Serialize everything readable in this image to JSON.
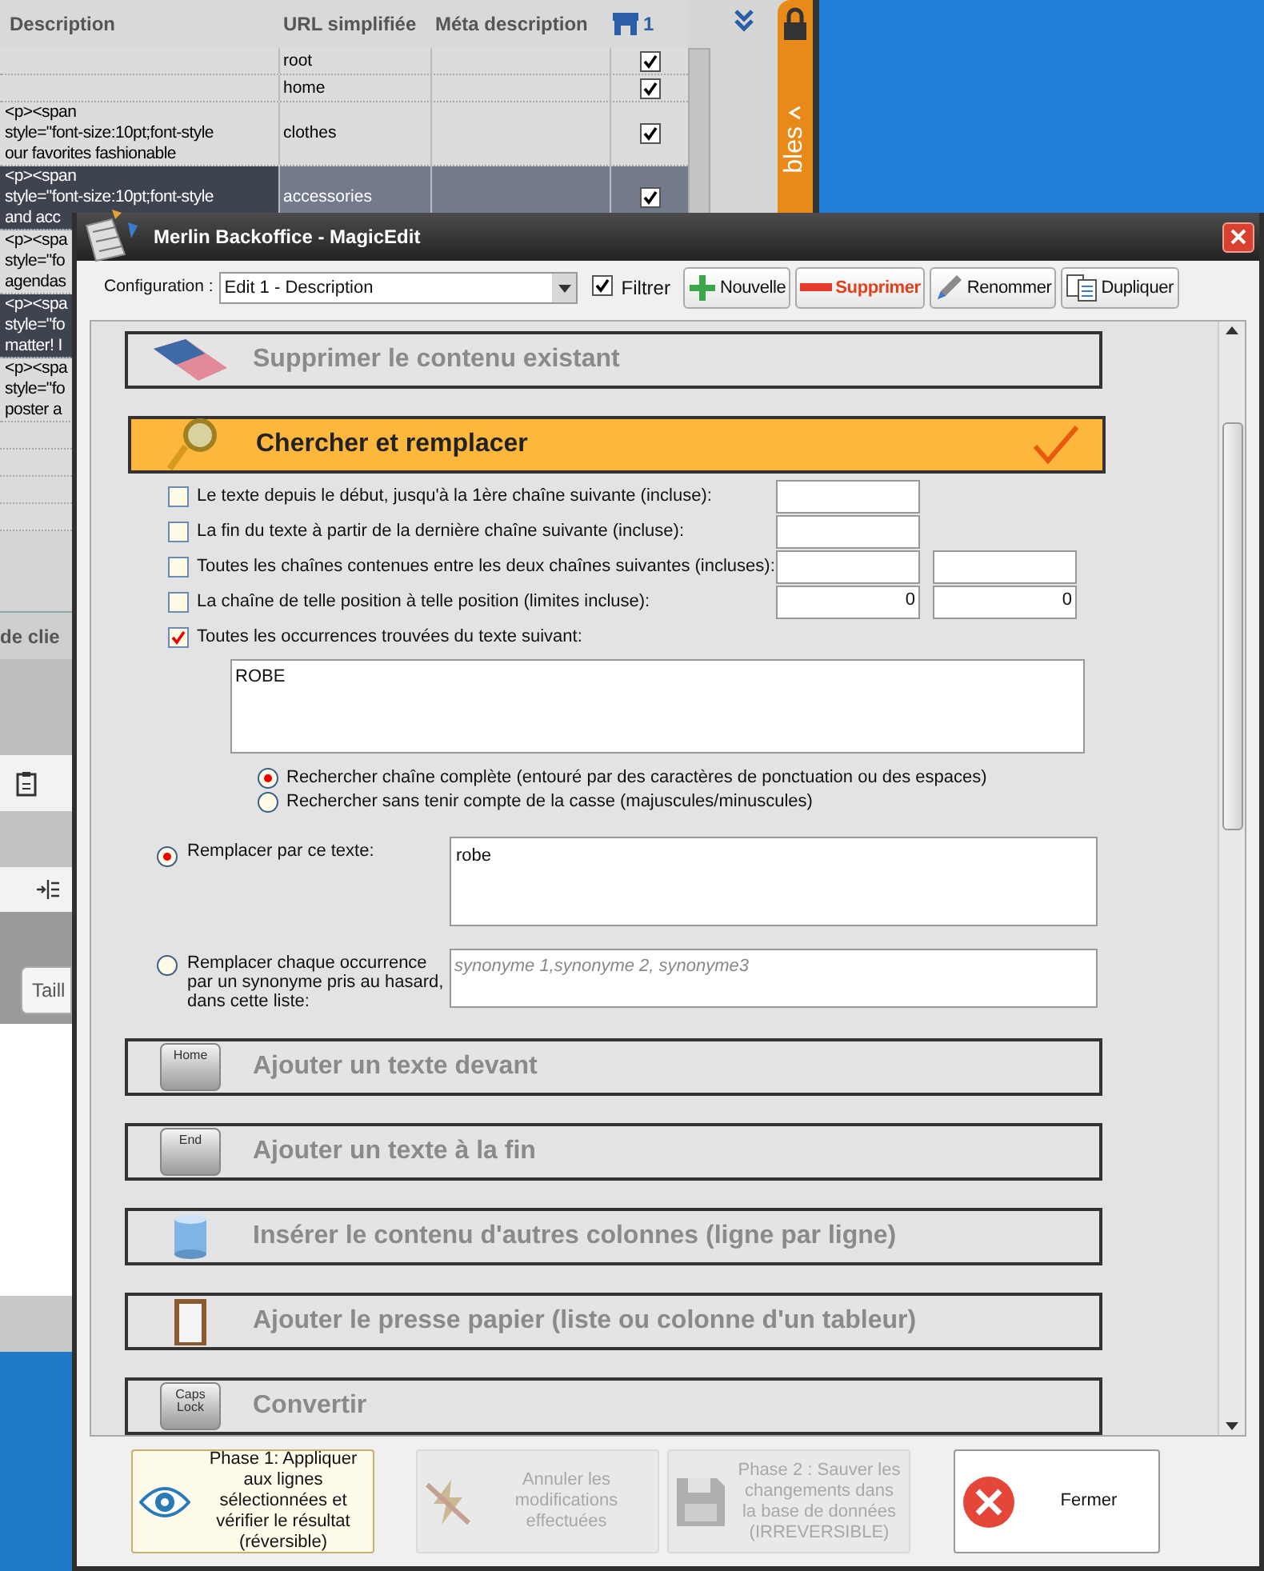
{
  "background_window": {
    "table": {
      "columns": [
        "Description",
        "URL simplifiée",
        "Méta description",
        "1"
      ],
      "rows": [
        {
          "url": "root",
          "checked": true,
          "selected": false
        },
        {
          "url": "home",
          "checked": true,
          "selected": false
        },
        {
          "description": [
            "<p><span",
            "style=\"font-size:10pt;font-style",
            "our favorites fashionable"
          ],
          "url": "clothes",
          "checked": true,
          "selected": false
        },
        {
          "description": [
            "<p><span",
            "style=\"font-size:10pt;font-style",
            "and acc"
          ],
          "url": "accessories",
          "checked": true,
          "selected": true
        },
        {
          "description": [
            "<p><spa",
            "style=\"fo",
            "agendas"
          ],
          "selected": false
        },
        {
          "description": [
            "<p><spa",
            "style=\"fo",
            "matter! I"
          ],
          "selected": true
        },
        {
          "description": [
            "<p><spa",
            "style=\"fo",
            "poster a"
          ],
          "selected": false
        }
      ]
    },
    "side_tab": "bles",
    "tab_label": "de clie",
    "button_label": "Taill"
  },
  "dialog": {
    "title": "Merlin Backoffice - MagicEdit",
    "config_label": "Configuration :",
    "config_value": "Edit 1 - Description",
    "filter": {
      "label": "Filtrer",
      "checked": true
    },
    "toolbar": [
      {
        "label": "Nouvelle",
        "kind": "add"
      },
      {
        "label": "Supprimer",
        "kind": "delete"
      },
      {
        "label": "Renommer",
        "kind": "rename"
      },
      {
        "label": "Dupliquer",
        "kind": "duplicate"
      }
    ],
    "sections": [
      {
        "title": "Supprimer le contenu existant",
        "expanded": false
      },
      {
        "title": "Chercher et remplacer",
        "expanded": true
      },
      {
        "title": "Ajouter un texte devant",
        "key_label": "Home",
        "expanded": false
      },
      {
        "title": "Ajouter un texte à la fin",
        "key_label": "End",
        "expanded": false
      },
      {
        "title": "Insérer le contenu d'autres colonnes (ligne par ligne)",
        "expanded": false
      },
      {
        "title": "Ajouter le presse papier (liste ou colonne d'un tableur)",
        "expanded": false
      },
      {
        "title": "Convertir",
        "key_label": "Caps Lock",
        "expanded": false
      }
    ],
    "search_replace": {
      "criteria": [
        {
          "label": "Le texte depuis le début, jusqu'à la 1ère chaîne suivante (incluse):",
          "checked": false,
          "kind": "one_field"
        },
        {
          "label": "La fin du texte à partir de la dernière chaîne suivante (incluse):",
          "checked": false,
          "kind": "one_field"
        },
        {
          "label": "Toutes les chaînes contenues entre les deux chaînes suivantes (incluses):",
          "checked": false,
          "kind": "two_fields"
        },
        {
          "label": "La chaîne de telle position à telle position (limites incluse):",
          "checked": false,
          "kind": "two_numbers",
          "values": [
            "0",
            "0"
          ]
        },
        {
          "label": "Toutes les occurrences trouvées du texte suivant:",
          "checked": true,
          "kind": "text_area",
          "value": "ROBE"
        }
      ],
      "match_options": [
        {
          "label": "Rechercher chaîne complète (entouré par des caractères de ponctuation ou des espaces)",
          "selected": true
        },
        {
          "label": "Rechercher sans tenir compte de la casse (majuscules/minuscules)",
          "selected": false
        }
      ],
      "replace_options": [
        {
          "label": "Remplacer par ce texte:",
          "selected": true,
          "value": "robe"
        },
        {
          "label": "Remplacer chaque occurrence par un synonyme pris au hasard, dans cette liste:",
          "selected": false,
          "placeholder": "synonyme 1,synonyme 2, synonyme3"
        }
      ]
    },
    "actions": [
      {
        "label": "Phase 1: Appliquer aux lignes sélectionnées et vérifier le résultat (réversible)",
        "disabled": false,
        "focused": true
      },
      {
        "label": "Annuler les modifications effectuées",
        "disabled": true,
        "focused": false
      },
      {
        "label": "Phase 2 : Sauver les changements dans la base de données (IRREVERSIBLE)",
        "disabled": true,
        "focused": false
      },
      {
        "label": "Fermer",
        "disabled": false,
        "focused": false
      }
    ]
  }
}
